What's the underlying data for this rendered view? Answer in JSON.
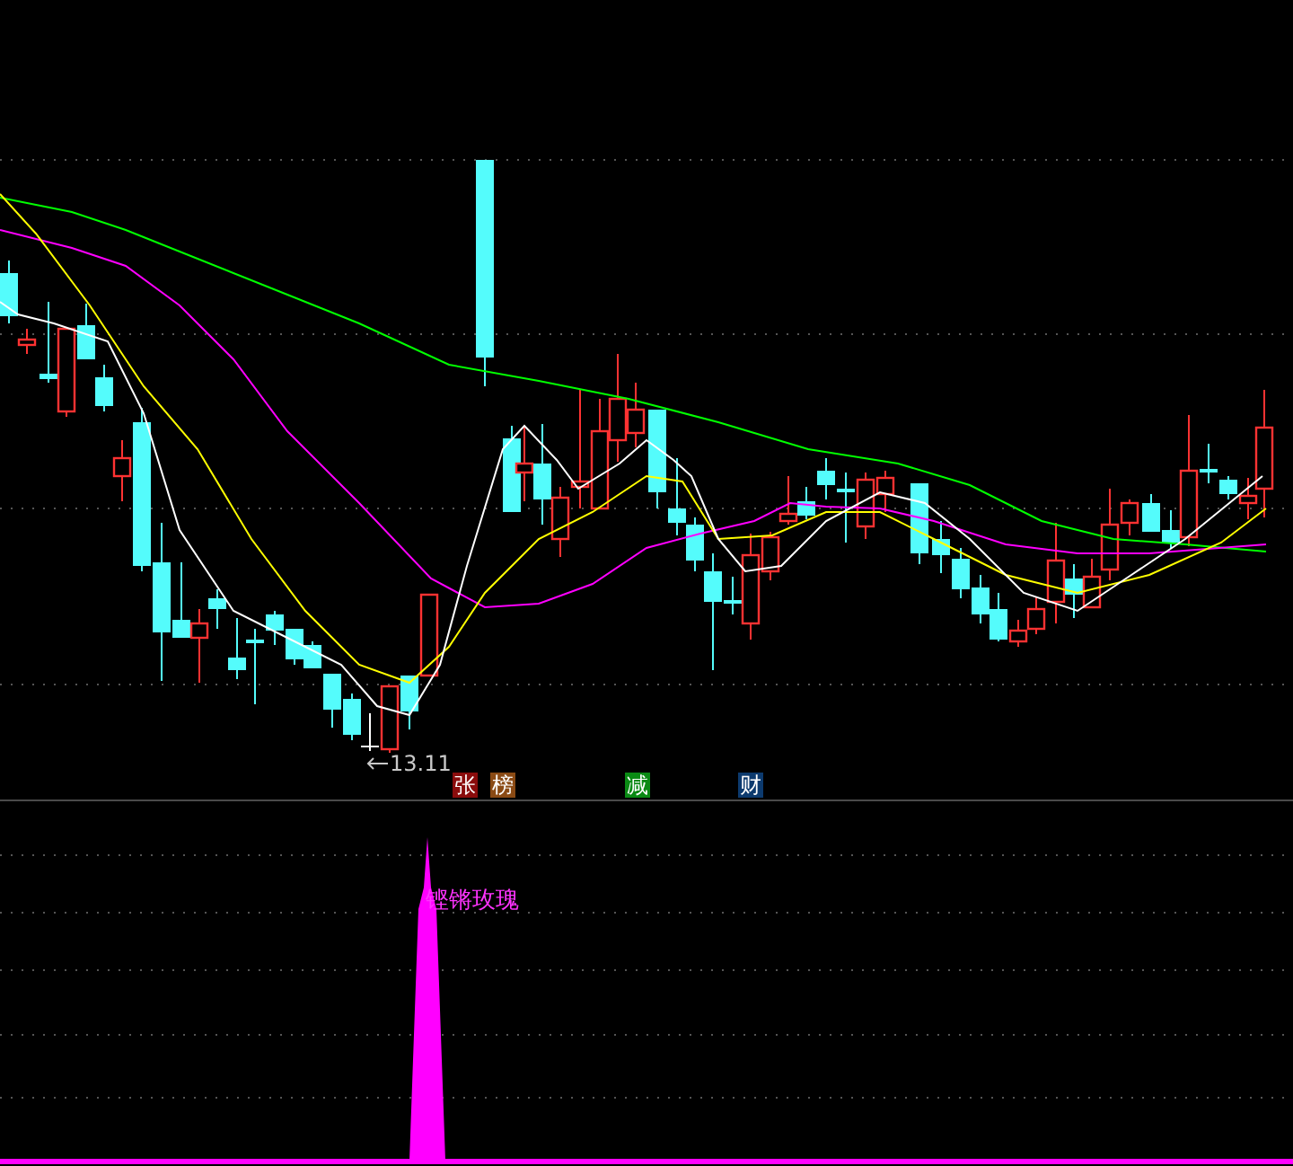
{
  "main_chart": {
    "low_price_label": "13.11",
    "tags": [
      {
        "label": "张",
        "color": "#8a0c0c"
      },
      {
        "label": "榜",
        "color": "#8a4a14"
      },
      {
        "label": "减",
        "color": "#0a8a14"
      },
      {
        "label": "财",
        "color": "#0c3a6e"
      }
    ]
  },
  "indicator_panel": {
    "signal_label": "铿锵玫瑰"
  }
}
